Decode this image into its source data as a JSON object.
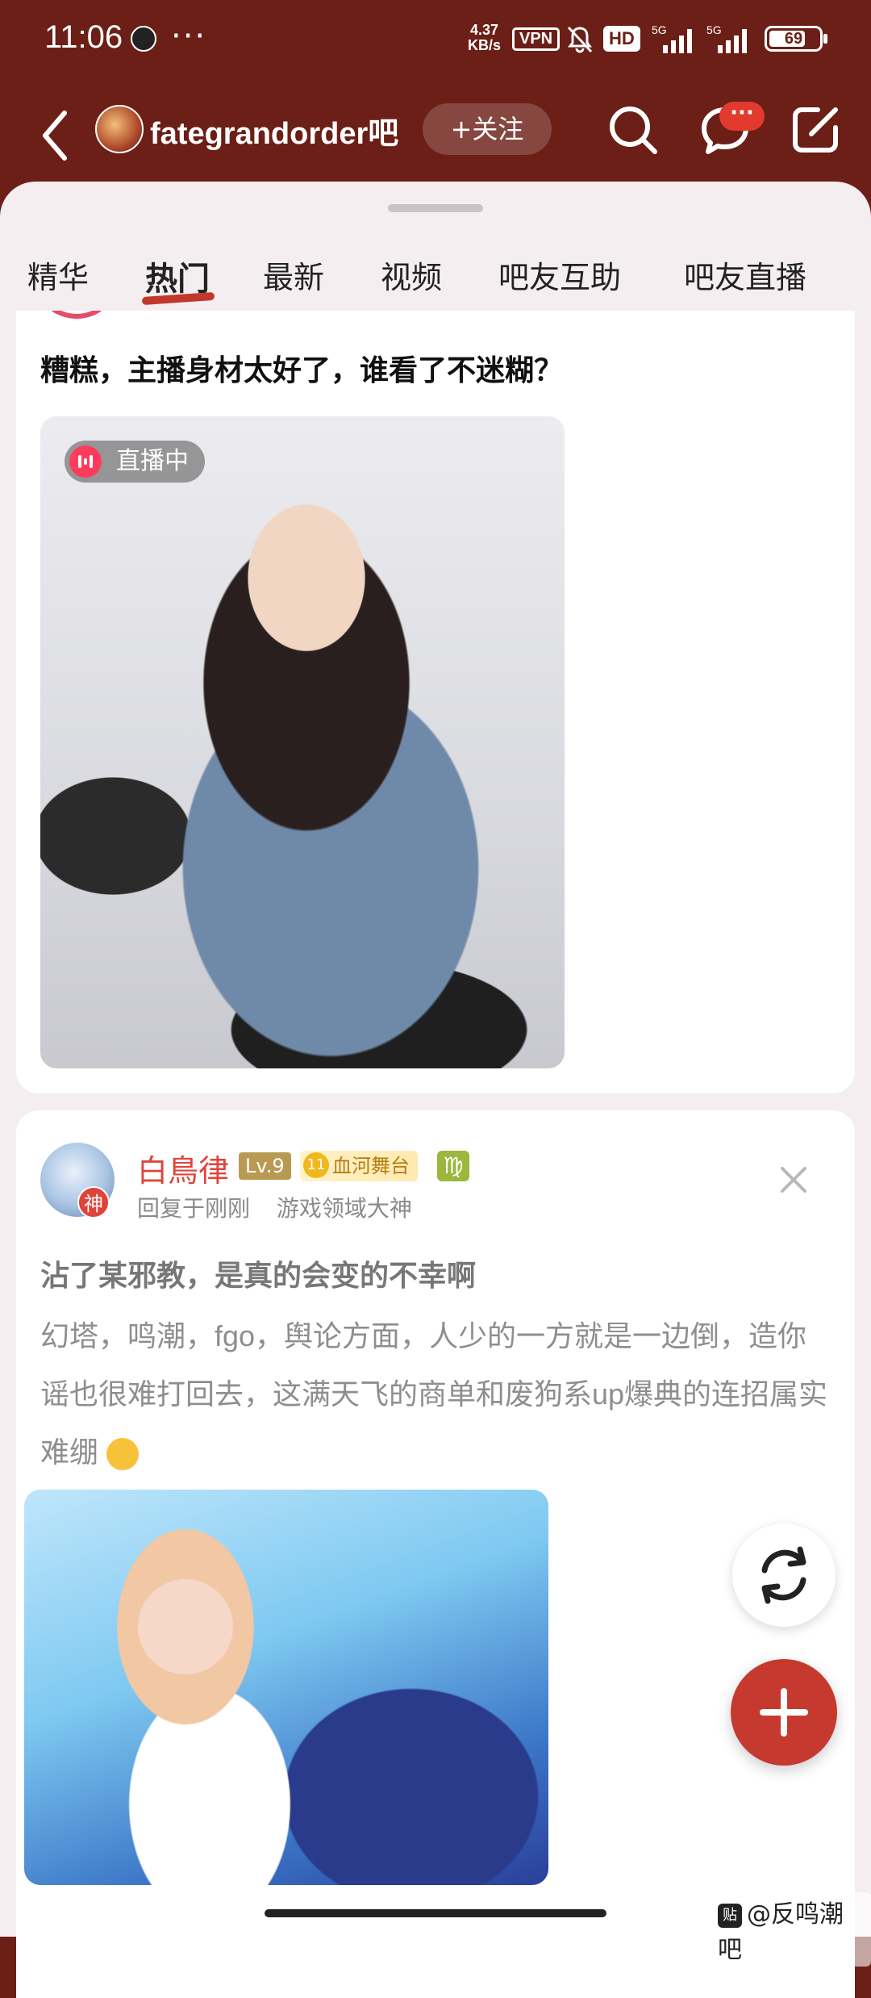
{
  "status_bar": {
    "time": "11:06",
    "app_icon_label": "潮",
    "more": "···",
    "speed_value": "4.37",
    "speed_unit": "KB/s",
    "vpn": "VPN",
    "hd": "HD",
    "signal_1": "5G",
    "signal_2": "5G",
    "battery": "69"
  },
  "header": {
    "forum_name": "fategrandorder吧",
    "follow_label": "+关注",
    "message_badge": "···"
  },
  "tabs": [
    {
      "label": "精华"
    },
    {
      "label": "热门"
    },
    {
      "label": "最新"
    },
    {
      "label": "视频"
    },
    {
      "label": "吧友互助"
    },
    {
      "label": "吧友直播"
    }
  ],
  "post1": {
    "title": "糟糕，主播身材太好了，谁看了不迷糊？",
    "live_label": "直播中"
  },
  "post2": {
    "author": "白鳥律",
    "level": "Lv.9",
    "member_level": "11",
    "member_badge": "血河舞台",
    "zodiac": "♍",
    "god_badge": "神",
    "reply_time": "回复于刚刚",
    "author_title": "游戏领域大神",
    "title": "沾了某邪教，是真的会变的不幸啊",
    "body": "幻塔，鸣潮，fgo，舆论方面，人少的一方就是一边倒，造你谣也很难打回去，这满天飞的商单和废狗系up爆典的连招属实难绷"
  },
  "watermark": {
    "icon": "贴",
    "text": "@反鸣潮吧"
  },
  "colors": {
    "header_bg": "#6b1f16",
    "accent": "#c6392e",
    "author_red": "#e0433a"
  },
  "icons": [
    "back-icon",
    "search-icon",
    "message-icon",
    "edit-icon",
    "close-icon",
    "refresh-icon",
    "plus-icon",
    "bell-muted-icon",
    "live-icon"
  ]
}
